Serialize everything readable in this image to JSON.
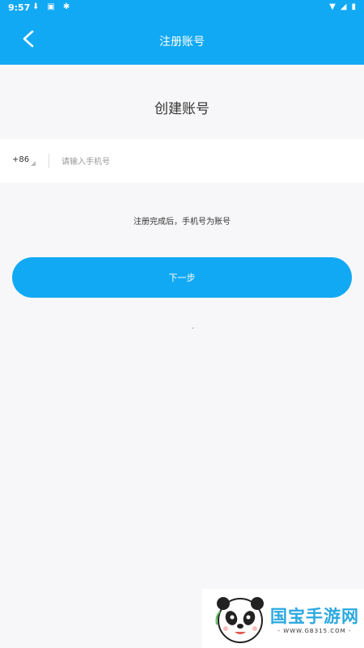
{
  "status_bar": {
    "time": "9:57",
    "icons": [
      "download-icon",
      "a-icon",
      "bug-icon"
    ],
    "right_icons": [
      "wifi-icon",
      "signal-icon",
      "battery-icon"
    ]
  },
  "nav": {
    "title": "注册账号"
  },
  "form": {
    "heading": "创建账号",
    "country_code": "+86",
    "phone_placeholder": "请输入手机号",
    "hint": "注册完成后，手机号为账号",
    "next_label": "下一步"
  },
  "watermark": {
    "title": "国宝手游网",
    "url": "- WWW.GB315.COM -"
  },
  "colors": {
    "accent": "#12a9f4",
    "background": "#f7f7f9"
  }
}
